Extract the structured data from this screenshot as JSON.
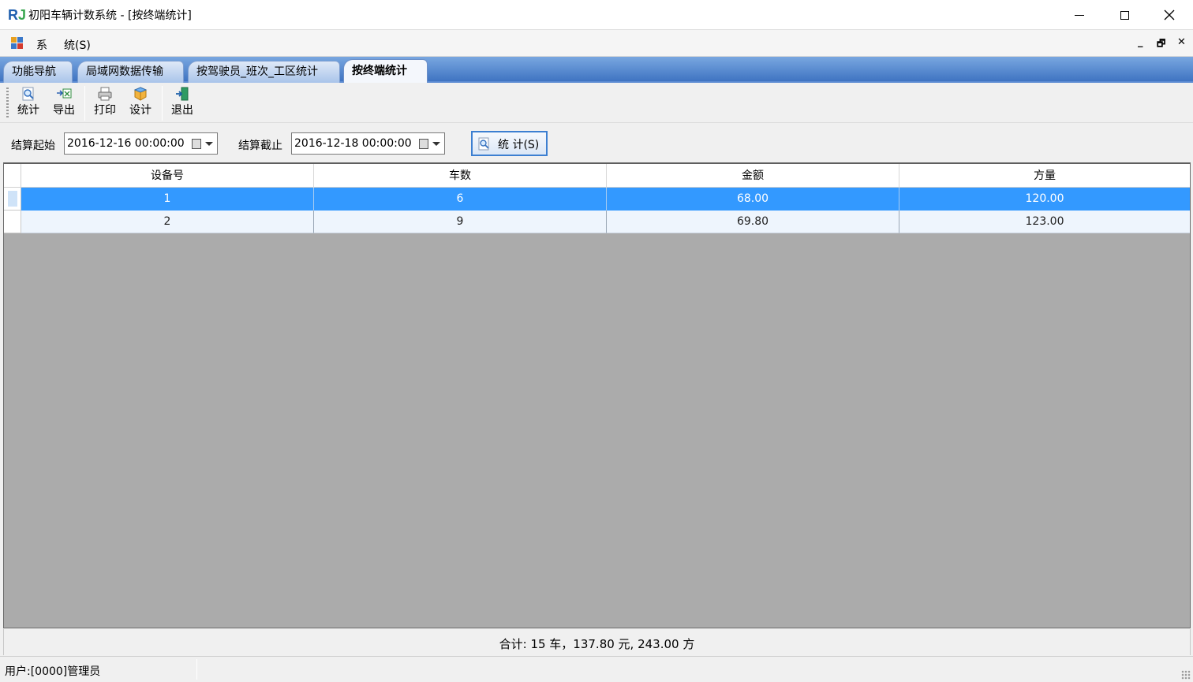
{
  "window": {
    "title": "初阳车辆计数系统 - [按终端统计]",
    "logo_r": "R",
    "logo_j": "J"
  },
  "menu": {
    "items": [
      "系",
      "统(S)"
    ],
    "mdi_controls": [
      "_",
      "🗗",
      "✕"
    ]
  },
  "tabs": [
    {
      "label": "功能导航",
      "active": false
    },
    {
      "label": "局域网数据传输",
      "active": false
    },
    {
      "label": "按驾驶员_班次_工区统计",
      "active": false
    },
    {
      "label": "按终端统计",
      "active": true
    }
  ],
  "toolbar": {
    "stat": "统计",
    "export": "导出",
    "print": "打印",
    "design": "设计",
    "exit": "退出"
  },
  "filter": {
    "start_label": "结算起始",
    "start_value": "2016-12-16 00:00:00",
    "end_label": "结算截止",
    "end_value": "2016-12-18 00:00:00",
    "button_label": "统 计(S)"
  },
  "grid": {
    "columns": [
      "设备号",
      "车数",
      "金额",
      "方量"
    ],
    "rows": [
      {
        "device": "1",
        "cars": "6",
        "amount": "68.00",
        "volume": "120.00",
        "selected": true
      },
      {
        "device": "2",
        "cars": "9",
        "amount": "69.80",
        "volume": "123.00",
        "selected": false
      }
    ]
  },
  "summary": "合计: 15 车，137.80 元, 243.00 方",
  "status": {
    "user": "用户:[0000]管理员"
  },
  "colors": {
    "selection": "#3399ff",
    "tab_strip": "#3f74c2",
    "grid_background": "#ababab"
  }
}
